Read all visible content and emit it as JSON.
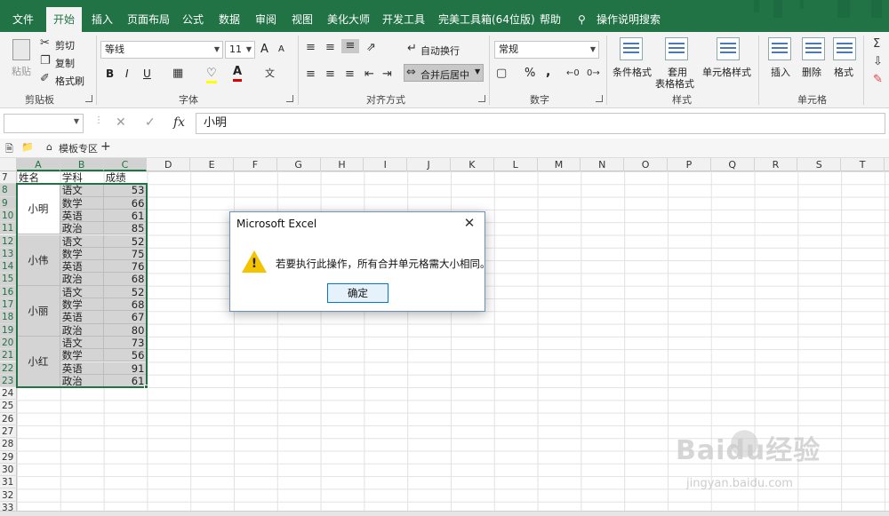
{
  "ribbon_tabs": [
    {
      "label": "文件",
      "active": false
    },
    {
      "label": "开始",
      "active": true
    },
    {
      "label": "插入",
      "active": false
    },
    {
      "label": "页面布局",
      "active": false
    },
    {
      "label": "公式",
      "active": false
    },
    {
      "label": "数据",
      "active": false
    },
    {
      "label": "审阅",
      "active": false
    },
    {
      "label": "视图",
      "active": false
    },
    {
      "label": "美化大师",
      "active": false
    },
    {
      "label": "开发工具",
      "active": false
    },
    {
      "label": "完美工具箱(64位版)",
      "active": false
    },
    {
      "label": "帮助",
      "active": false
    }
  ],
  "tell_me": "操作说明搜索",
  "clipboard": {
    "paste": "粘贴",
    "cut": "剪切",
    "copy": "复制",
    "format_painter": "格式刷",
    "group": "剪贴板"
  },
  "font": {
    "name": "等线",
    "size": "11",
    "bold": "B",
    "italic": "I",
    "underline": "U",
    "grow": "A",
    "shrink": "A",
    "group": "字体"
  },
  "alignment": {
    "wrap": "自动换行",
    "merge": "合并后居中",
    "group": "对齐方式"
  },
  "number": {
    "format": "常规",
    "percent": "%",
    "comma": ",",
    "group": "数字"
  },
  "styles": {
    "conditional": "条件格式",
    "table": "套用",
    "table2": "表格格式",
    "cell_style": "单元格样式",
    "group": "样式"
  },
  "cells_group": {
    "insert": "插入",
    "delete": "删除",
    "format": "格式",
    "group": "单元格"
  },
  "formula": {
    "name_box": "",
    "fx": "fx",
    "value": "小明"
  },
  "doc_strip": {
    "template_zone": "模板专区",
    "add": "+"
  },
  "columns": [
    "A",
    "B",
    "C",
    "D",
    "E",
    "F",
    "G",
    "H",
    "I",
    "J",
    "K",
    "L",
    "M",
    "N",
    "O",
    "P",
    "Q",
    "R",
    "S",
    "T"
  ],
  "rows": [
    "7",
    "8",
    "9",
    "10",
    "11",
    "12",
    "13",
    "14",
    "15",
    "16",
    "17",
    "18",
    "19",
    "20",
    "21",
    "22",
    "23",
    "24",
    "25",
    "26",
    "27",
    "28",
    "29",
    "30",
    "31",
    "32",
    "33"
  ],
  "headers": {
    "name": "姓名",
    "subject": "学科",
    "score": "成绩"
  },
  "students": [
    {
      "name": "小明",
      "subjects": [
        "语文",
        "数学",
        "英语",
        "政治"
      ],
      "scores": [
        53,
        66,
        61,
        85
      ]
    },
    {
      "name": "小伟",
      "subjects": [
        "语文",
        "数学",
        "英语",
        "政治"
      ],
      "scores": [
        52,
        75,
        76,
        68
      ]
    },
    {
      "name": "小丽",
      "subjects": [
        "语文",
        "数学",
        "英语",
        "政治"
      ],
      "scores": [
        52,
        68,
        67,
        80
      ]
    },
    {
      "name": "小红",
      "subjects": [
        "语文",
        "数学",
        "英语",
        "政治"
      ],
      "scores": [
        73,
        56,
        91,
        61
      ]
    }
  ],
  "dialog": {
    "title": "Microsoft Excel",
    "message": "若要执行此操作，所有合并单元格需大小相同。",
    "ok": "确定",
    "close": "✕",
    "warn": "!"
  },
  "watermark": {
    "logo": "Baidu经验",
    "url": "jingyan.baidu.com"
  }
}
